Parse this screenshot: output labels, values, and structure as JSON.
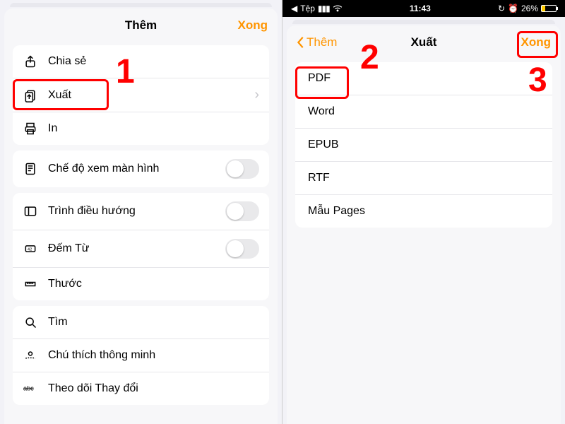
{
  "colors": {
    "accent": "#ff9500",
    "callout": "#ff0000"
  },
  "annotations": {
    "step1": "1",
    "step2": "2",
    "step3": "3"
  },
  "left": {
    "nav": {
      "title": "Thêm",
      "done": "Xong"
    },
    "group1": {
      "share": "Chia sẻ",
      "export": "Xuất",
      "print": "In"
    },
    "group2": {
      "screen_view": "Chế độ xem màn hình"
    },
    "group3": {
      "navigator": "Trình điều hướng",
      "word_count": "Đếm Từ",
      "ruler": "Thước"
    },
    "group4": {
      "find": "Tìm",
      "smart_annotation": "Chú thích thông minh",
      "track_changes": "Theo dõi Thay đổi"
    }
  },
  "right": {
    "status": {
      "carrier_back": "Tệp",
      "time": "11:43",
      "battery_pct": "26%"
    },
    "nav": {
      "back": "Thêm",
      "title": "Xuất",
      "done": "Xong"
    },
    "formats": {
      "pdf": "PDF",
      "word": "Word",
      "epub": "EPUB",
      "rtf": "RTF",
      "pages_template": "Mẫu Pages"
    }
  }
}
